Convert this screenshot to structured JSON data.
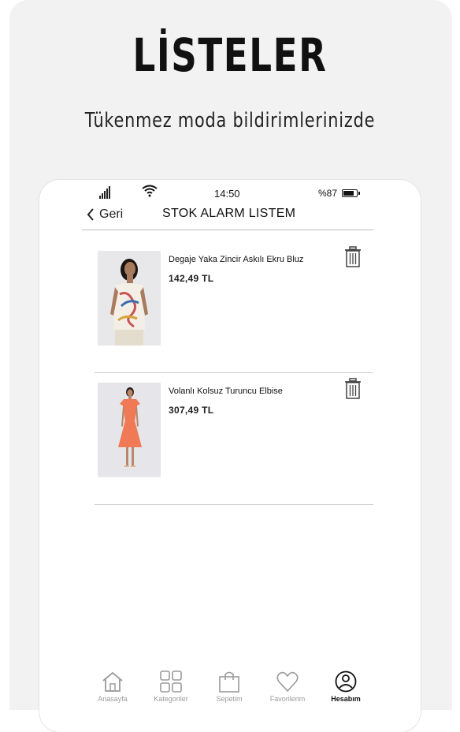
{
  "promo": {
    "title": "LİSTELER",
    "subtitle": "Tükenmez moda bildirimlerinizde"
  },
  "status_bar": {
    "time": "14:50",
    "battery": "%87",
    "battery_level": 0.87
  },
  "header": {
    "back_label": "Geri",
    "title": "STOK ALARM LISTEM"
  },
  "items": [
    {
      "name": "Degaje Yaka Zincir Askılı Ekru Bluz",
      "price": "142,49 TL"
    },
    {
      "name": "Volanlı Kolsuz Turuncu Elbise",
      "price": "307,49 TL"
    }
  ],
  "tabs": [
    {
      "label": "Anasayfa",
      "icon": "home-icon"
    },
    {
      "label": "Kategoriler",
      "icon": "grid-icon"
    },
    {
      "label": "Sepetim",
      "icon": "shopping-bag-icon"
    },
    {
      "label": "Favorilerim",
      "icon": "heart-icon"
    },
    {
      "label": "Hesabım",
      "icon": "user-icon",
      "active": true
    }
  ],
  "colors": {
    "background_card": "#f2f2f2",
    "text_primary": "#111111",
    "tab_inactive": "#9a9a9a",
    "dress_orange": "#f07a55"
  }
}
